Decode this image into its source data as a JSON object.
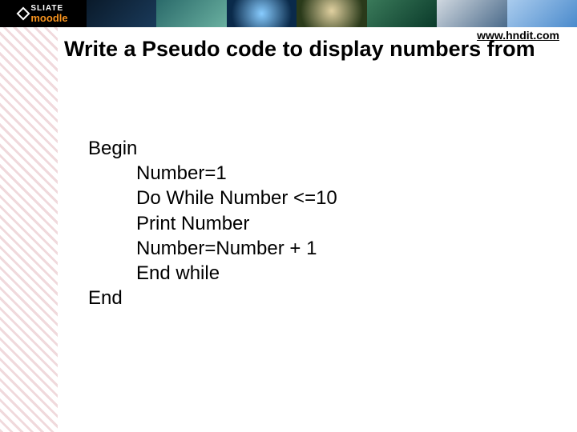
{
  "header": {
    "logo_top": "SLIATE",
    "logo_bottom": "moodle"
  },
  "url": "www.hndit.com",
  "title": "Write a Pseudo code to display  numbers from",
  "code": {
    "l1": "Begin",
    "l2": "Number=1",
    "l3": "Do While Number <=10",
    "l4": "Print  Number",
    "l5": "Number=Number + 1",
    "l6": "End while",
    "l7": "End"
  }
}
